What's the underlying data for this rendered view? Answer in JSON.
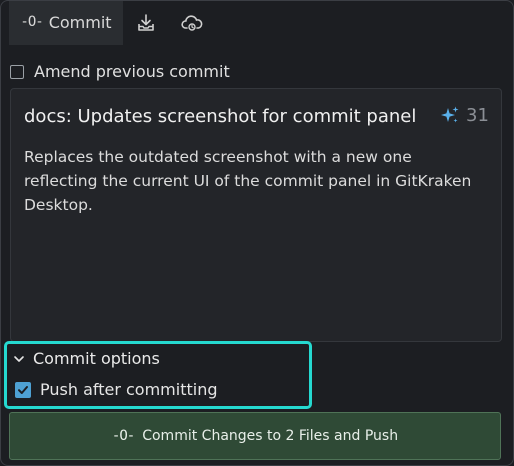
{
  "tabs": {
    "commit_label": "Commit",
    "commit_icon": "commit-node-icon",
    "stash_icon": "download-tray-icon",
    "cloud_icon": "cloud-sync-icon"
  },
  "amend": {
    "label": "Amend previous commit",
    "checked": false
  },
  "message": {
    "summary": "docs: Updates screenshot for commit panel",
    "char_count": "31",
    "ai_icon": "sparkle-icon",
    "description": "Replaces the outdated screenshot with a new one reflecting the current UI of the commit panel in GitKraken Desktop."
  },
  "options": {
    "header": "Commit options",
    "expanded": true,
    "push_label": "Push after committing",
    "push_checked": true
  },
  "commit_button": {
    "label": "Commit Changes to 2 Files and Push"
  },
  "colors": {
    "highlight": "#25d9d0",
    "checkbox": "#4ea1d3",
    "commit_button_bg": "#2f4a36",
    "sparkle": "#5ab0ea"
  }
}
